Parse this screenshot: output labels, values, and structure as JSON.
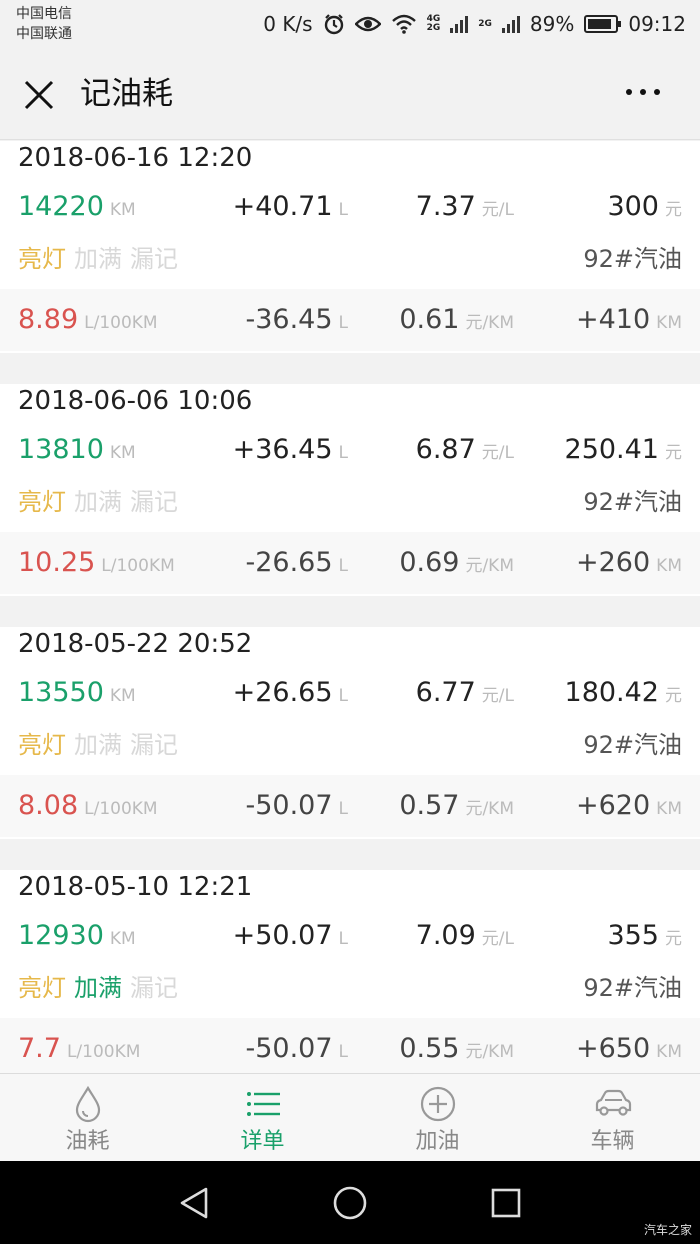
{
  "status": {
    "carrier1": "中国电信",
    "carrier2": "中国联通",
    "speed": "0 K/s",
    "net_4g": "4G",
    "net_2g_a": "2G",
    "net_2g_b": "2G",
    "battery": "89%",
    "battery_level": 0.89,
    "time": "09:12"
  },
  "header": {
    "title": "记油耗"
  },
  "records": [
    {
      "date": "2018-06-16 12:20",
      "odometer": "14220",
      "odometer_unit": "KM",
      "fuel_added": "+40.71",
      "fuel_unit": "L",
      "price": "7.37",
      "price_unit": "元/L",
      "cost": "300",
      "cost_unit": "元",
      "tag_light": "亮灯",
      "tag_full": "加满",
      "tag_missed": "漏记",
      "full_active": false,
      "fuel_type": "92#汽油",
      "consumption": "8.89",
      "consumption_unit": "L/100KM",
      "delta_fuel": "-36.45",
      "delta_unit": "L",
      "cost_per_km": "0.61",
      "cost_per_km_unit": "元/KM",
      "distance": "+410",
      "distance_unit": "KM"
    },
    {
      "date": "2018-06-06 10:06",
      "odometer": "13810",
      "odometer_unit": "KM",
      "fuel_added": "+36.45",
      "fuel_unit": "L",
      "price": "6.87",
      "price_unit": "元/L",
      "cost": "250.41",
      "cost_unit": "元",
      "tag_light": "亮灯",
      "tag_full": "加满",
      "tag_missed": "漏记",
      "full_active": false,
      "fuel_type": "92#汽油",
      "consumption": "10.25",
      "consumption_unit": "L/100KM",
      "delta_fuel": "-26.65",
      "delta_unit": "L",
      "cost_per_km": "0.69",
      "cost_per_km_unit": "元/KM",
      "distance": "+260",
      "distance_unit": "KM"
    },
    {
      "date": "2018-05-22 20:52",
      "odometer": "13550",
      "odometer_unit": "KM",
      "fuel_added": "+26.65",
      "fuel_unit": "L",
      "price": "6.77",
      "price_unit": "元/L",
      "cost": "180.42",
      "cost_unit": "元",
      "tag_light": "亮灯",
      "tag_full": "加满",
      "tag_missed": "漏记",
      "full_active": false,
      "fuel_type": "92#汽油",
      "consumption": "8.08",
      "consumption_unit": "L/100KM",
      "delta_fuel": "-50.07",
      "delta_unit": "L",
      "cost_per_km": "0.57",
      "cost_per_km_unit": "元/KM",
      "distance": "+620",
      "distance_unit": "KM"
    },
    {
      "date": "2018-05-10 12:21",
      "odometer": "12930",
      "odometer_unit": "KM",
      "fuel_added": "+50.07",
      "fuel_unit": "L",
      "price": "7.09",
      "price_unit": "元/L",
      "cost": "355",
      "cost_unit": "元",
      "tag_light": "亮灯",
      "tag_full": "加满",
      "tag_missed": "漏记",
      "full_active": true,
      "fuel_type": "92#汽油",
      "consumption": "7.7",
      "consumption_unit": "L/100KM",
      "delta_fuel": "-50.07",
      "delta_unit": "L",
      "cost_per_km": "0.55",
      "cost_per_km_unit": "元/KM",
      "distance": "+650",
      "distance_unit": "KM"
    }
  ],
  "nav": [
    {
      "label": "油耗",
      "icon": "drop-icon",
      "active": false
    },
    {
      "label": "详单",
      "icon": "list-icon",
      "active": true
    },
    {
      "label": "加油",
      "icon": "plus-circle-icon",
      "active": false
    },
    {
      "label": "车辆",
      "icon": "car-icon",
      "active": false
    }
  ],
  "watermark": "汽车之家",
  "colors": {
    "accent": "#1aa06a",
    "warn": "#d9534f",
    "light": "#e6b84a"
  }
}
